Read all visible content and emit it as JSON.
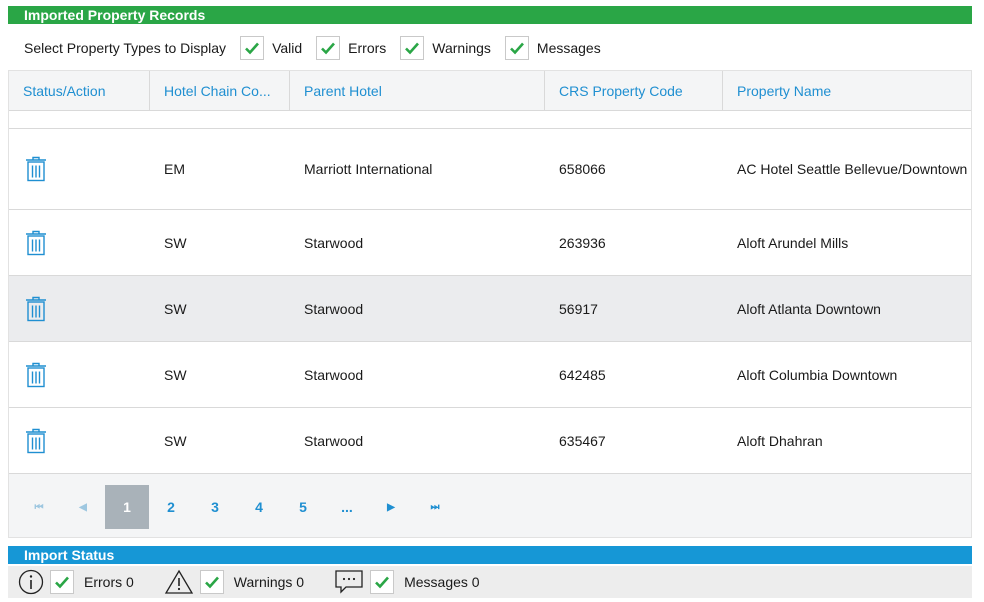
{
  "records_title": "Imported Property Records",
  "filters": {
    "label": "Select Property Types to Display",
    "items": [
      {
        "label": "Valid",
        "checked": true
      },
      {
        "label": "Errors",
        "checked": true
      },
      {
        "label": "Warnings",
        "checked": true
      },
      {
        "label": "Messages",
        "checked": true
      }
    ]
  },
  "columns": [
    "Status/Action",
    "Hotel Chain Co...",
    "Parent Hotel",
    "CRS Property Code",
    "Property Name"
  ],
  "rows": [
    {
      "action_icon": "trash-icon",
      "chain": "EM",
      "parent": "Marriott International",
      "code": "658066",
      "name": "AC Hotel Seattle Bellevue/Downtown"
    },
    {
      "action_icon": "trash-icon",
      "chain": "SW",
      "parent": "Starwood",
      "code": "263936",
      "name": "Aloft Arundel Mills"
    },
    {
      "action_icon": "trash-icon",
      "chain": "SW",
      "parent": "Starwood",
      "code": "56917",
      "name": "Aloft Atlanta Downtown"
    },
    {
      "action_icon": "trash-icon",
      "chain": "SW",
      "parent": "Starwood",
      "code": "642485",
      "name": "Aloft Columbia Downtown"
    },
    {
      "action_icon": "trash-icon",
      "chain": "SW",
      "parent": "Starwood",
      "code": "635467",
      "name": "Aloft Dhahran"
    }
  ],
  "pager": {
    "first": "⏮",
    "prev": "◀",
    "pages": [
      "1",
      "2",
      "3",
      "4",
      "5",
      "..."
    ],
    "active_page": "1",
    "next": "▶",
    "last": "⏭"
  },
  "status": {
    "title": "Import Status",
    "errors_label": "Errors 0",
    "warnings_label": "Warnings 0",
    "messages_label": "Messages 0"
  },
  "colors": {
    "records_bar": "#2aa646",
    "status_bar": "#1697d6",
    "link_blue": "#1f8fd1",
    "check_green": "#2aa646"
  }
}
